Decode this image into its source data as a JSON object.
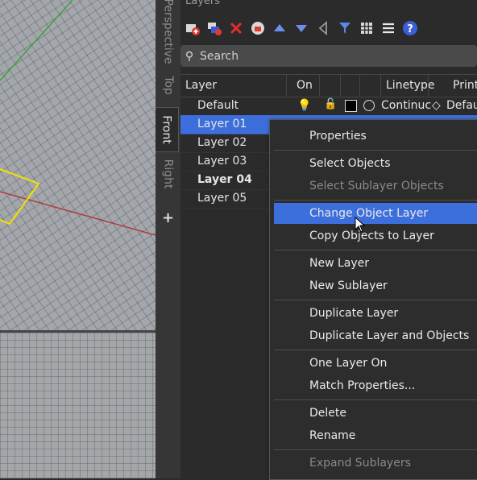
{
  "viewports": {
    "tabs": [
      {
        "label": "Perspective"
      },
      {
        "label": "Top"
      },
      {
        "label": "Front"
      },
      {
        "label": "Right"
      }
    ],
    "active_tab": "Front",
    "add_label": "+"
  },
  "layers_panel": {
    "title": "Layers",
    "toolbar": {
      "icons": [
        "new-layer-icon",
        "new-sublayer-icon",
        "delete-icon",
        "layer-state-icon",
        "move-up-icon",
        "move-down-icon",
        "move-out-icon",
        "filter-icon",
        "columns-icon",
        "menu-icon",
        "help-icon"
      ]
    },
    "search": {
      "placeholder": "Search"
    },
    "columns": [
      "Layer",
      "On",
      "",
      "",
      "",
      "Linetype",
      "Print"
    ],
    "rows": [
      {
        "name": "Default",
        "selected": false,
        "bold": false,
        "linetype": "Continuc",
        "print": "Defau"
      },
      {
        "name": "Layer 01",
        "selected": true,
        "bold": false
      },
      {
        "name": "Layer 02",
        "selected": false,
        "bold": false
      },
      {
        "name": "Layer 03",
        "selected": false,
        "bold": false
      },
      {
        "name": "Layer 04",
        "selected": false,
        "bold": true
      },
      {
        "name": "Layer 05",
        "selected": false,
        "bold": false
      }
    ]
  },
  "context_menu": {
    "items": [
      {
        "label": "Properties",
        "enabled": true
      },
      {
        "label": "Select Objects",
        "enabled": true
      },
      {
        "label": "Select Sublayer Objects",
        "enabled": false
      },
      {
        "label": "Change Object Layer",
        "enabled": true,
        "highlighted": true
      },
      {
        "label": "Copy Objects to Layer",
        "enabled": true
      },
      {
        "label": "New Layer",
        "enabled": true
      },
      {
        "label": "New Sublayer",
        "enabled": true
      },
      {
        "label": "Duplicate Layer",
        "enabled": true
      },
      {
        "label": "Duplicate Layer and Objects",
        "enabled": true
      },
      {
        "label": "One Layer On",
        "enabled": true
      },
      {
        "label": "Match Properties...",
        "enabled": true
      },
      {
        "label": "Delete",
        "enabled": true
      },
      {
        "label": "Rename",
        "enabled": true
      },
      {
        "label": "Expand Sublayers",
        "enabled": false
      }
    ]
  },
  "colors": {
    "selection": "#3d6fdc",
    "panel_bg": "#2b2b2b",
    "viewport_grid": "#a3a7ab",
    "curve_yellow": "#f5e100",
    "x_axis": "#b23a3a",
    "y_axis": "#3aa33a"
  }
}
